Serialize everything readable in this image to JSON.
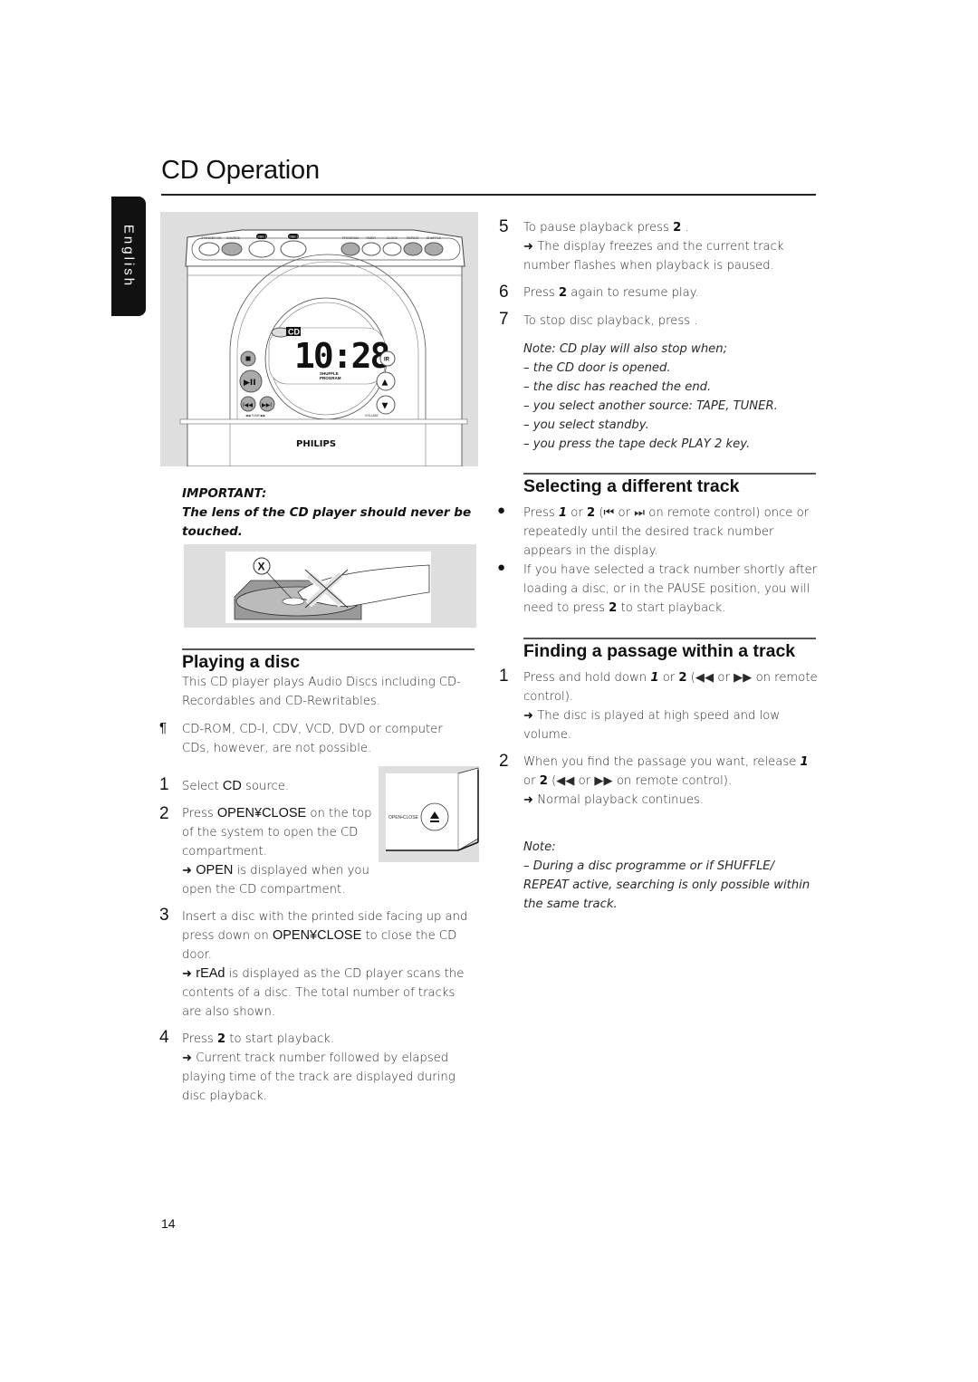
{
  "page": {
    "title": "CD Operation",
    "language_tab": "English",
    "page_number": "14"
  },
  "device_illustration": {
    "top_labels": [
      "STANDBY-ON",
      "SOURCE",
      "DBB 1",
      "DBB 2",
      "PROGRAM",
      "TIMER",
      "CLOCK",
      "REPEAT",
      "SHUFFLE"
    ],
    "display_source": "CD",
    "display_time": "10:28",
    "display_indicators": [
      "SHUFFLE",
      "PROGRAM"
    ],
    "left_buttons": [
      "stop",
      "play-pause",
      "previous",
      "next"
    ],
    "tune_label": "◀◀ TUNE ▶▶",
    "right_buttons": [
      "IR",
      "volume-up",
      "volume-down"
    ],
    "volume_label": "VOLUME",
    "brand": "PHILIPS"
  },
  "important": {
    "heading": "IMPORTANT:",
    "text": "The lens of the CD player should never be touched.",
    "figure_marker": "X"
  },
  "playing_disc": {
    "title": "Playing a disc",
    "intro": "This CD player plays Audio Discs including CD-Recordables and CD-Rewritables.",
    "warning_symbol": "¶",
    "warning": "CD-ROM, CD-I, CDV, VCD, DVD or computer CDs, however, are not possible.",
    "steps": [
      {
        "num": "1",
        "pre": "Select ",
        "key": "CD",
        "post": " source."
      },
      {
        "num": "2",
        "pre": "Press ",
        "key": "OPEN¥CLOSE",
        "post": " on the top of the system to open the CD compartment.",
        "result_key": "OPEN",
        "result": " is displayed when you open the CD compartment."
      },
      {
        "num": "3",
        "pre": "Insert a disc with the printed side facing up and press down on ",
        "key": "OPEN¥CLOSE",
        "post": " to close the CD door.",
        "result_key": "rEAd",
        "result": " is displayed as the CD player scans the contents of a disc. The total number of tracks are also shown."
      },
      {
        "num": "4",
        "pre": "Press ",
        "key": "2",
        "post": " to start playback.",
        "result": " Current track number followed by elapsed playing time of the track are displayed during disc playback."
      }
    ],
    "eject_label": "OPEN•CLOSE"
  },
  "right_steps": [
    {
      "num": "5",
      "pre": "To pause playback press ",
      "key": "2",
      "post": " .",
      "result": " The display freezes and the current track number flashes when playback is paused."
    },
    {
      "num": "6",
      "pre": "Press ",
      "key": "2",
      "post": " again to resume play."
    },
    {
      "num": "7",
      "pre": "To stop disc playback, press",
      "post": " ."
    }
  ],
  "stop_note": {
    "heading": "Note: CD play will also stop when;",
    "items": [
      "– the CD door is opened.",
      "– the disc has reached the end.",
      "– you select another source: TAPE, TUNER.",
      "– you select standby.",
      "– you press the tape deck PLAY 2 key."
    ]
  },
  "selecting_track": {
    "title": "Selecting a different track",
    "bullets": [
      {
        "pre": "Press  ",
        "k1": "1",
        "mid": " or ",
        "k2": "2",
        "post": "  (⏮ or ⏭ on remote control) once or repeatedly until the desired track number appears in the display."
      },
      {
        "pre": "If you have selected a track number shortly after loading a disc, or in the PAUSE position, you will need to press ",
        "k1": "2",
        "post": "  to start playback."
      }
    ]
  },
  "finding_passage": {
    "title": "Finding a passage within a track",
    "steps": [
      {
        "num": "1",
        "pre": "Press and hold down  ",
        "k1": "1",
        "mid": " or ",
        "k2": "2",
        "post": "  (◀◀ or ▶▶ on remote control).",
        "result": " The disc is played at high speed and low volume."
      },
      {
        "num": "2",
        "pre": "When you find the passage you want, release ",
        "k1": "1",
        "mid": " or ",
        "k2": "2",
        "post": "  (◀◀ or ▶▶ on remote control).",
        "result": " Normal playback continues."
      }
    ],
    "note_heading": "Note:",
    "note": "–  During a disc programme or if SHUFFLE/ REPEAT active, searching is only possible within the same track."
  },
  "symbols": {
    "arrow": "➜",
    "bullet": "●"
  }
}
